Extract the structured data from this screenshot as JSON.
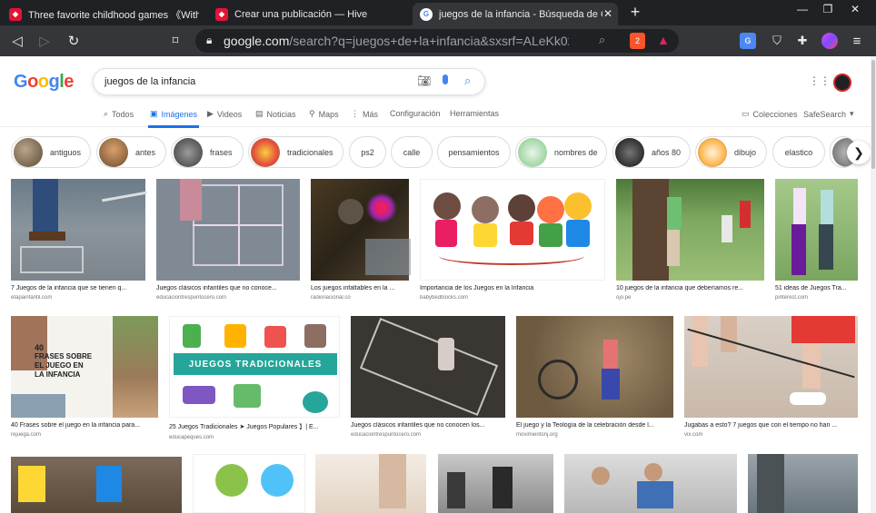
{
  "browser": {
    "tabs": [
      {
        "title": "Three favorite childhood games 《Withou",
        "favicon": "hive",
        "active": false
      },
      {
        "title": "Crear una publicación — Hive",
        "favicon": "hive",
        "active": false
      },
      {
        "title": "juegos de la infancia - Búsqueda de G",
        "favicon": "google",
        "active": true
      }
    ],
    "new_tab_label": "+",
    "url_host": "google.com",
    "url_path": "/search?q=juegos+de+la+infancia&sxsrf=ALeKk02gD...",
    "brave_badge_count": "2"
  },
  "google": {
    "logo_text": "Google",
    "query": "juegos de la infancia",
    "nav_tabs": [
      {
        "label": "Todos",
        "icon": "search-icon"
      },
      {
        "label": "Imágenes",
        "icon": "image-icon",
        "active": true
      },
      {
        "label": "Videos",
        "icon": "video-icon"
      },
      {
        "label": "Noticias",
        "icon": "news-icon"
      },
      {
        "label": "Maps",
        "icon": "map-pin-icon"
      },
      {
        "label": "Más",
        "icon": "more-icon"
      },
      {
        "label": "Configuración"
      },
      {
        "label": "Herramientas"
      }
    ],
    "collections_label": "Colecciones",
    "safesearch_label": "SafeSearch"
  },
  "chips": [
    {
      "label": "antiguos"
    },
    {
      "label": "antes"
    },
    {
      "label": "frases"
    },
    {
      "label": "tradicionales"
    },
    {
      "label": "ps2"
    },
    {
      "label": "calle"
    },
    {
      "label": "pensamientos"
    },
    {
      "label": "nombres de"
    },
    {
      "label": "años 80"
    },
    {
      "label": "dibujo"
    },
    {
      "label": "elastico"
    }
  ],
  "results_row1": [
    {
      "caption": "7 Juegos de la infancia que se tienen q...",
      "source": "etapainfantil.com"
    },
    {
      "caption": "Juegos clásicos infantiles que no conoce...",
      "source": "educaciontrespuntocero.com"
    },
    {
      "caption": "Los juegos infaltables en la ...",
      "source": "radionacional.co"
    },
    {
      "caption": "Importancia de los Juegos en la Infancia",
      "source": "babybedblocks.com"
    },
    {
      "caption": "10 juegos de la infancia que deberíamos re...",
      "source": "ojo.pe"
    },
    {
      "caption": "51 ideas de Juegos Tra...",
      "source": "pinterest.com"
    }
  ],
  "results_row2": [
    {
      "caption": "40 Frases sobre el juego en la infancia para...",
      "source": "rejuega.com"
    },
    {
      "caption": "25 Juegos Tradicionales ➤ Juegos Populares 】| E...",
      "source": "educapeques.com"
    },
    {
      "caption": "Juegos clásicos infantiles que no conocen los...",
      "source": "educaciontrespuntocero.com"
    },
    {
      "caption": "El juego y la Teología de la celebración desde l...",
      "source": "movimientonj.org"
    },
    {
      "caption": "Jugabas a esto? 7 juegos que con el tiempo no han ...",
      "source": "vix.com"
    }
  ],
  "image_text": {
    "frases_lines": [
      "40",
      "FRASES SOBRE",
      "EL JUEGO EN",
      "LA INFANCIA"
    ],
    "tradicionales_banner": "JUEGOS TRADICIONALES"
  }
}
